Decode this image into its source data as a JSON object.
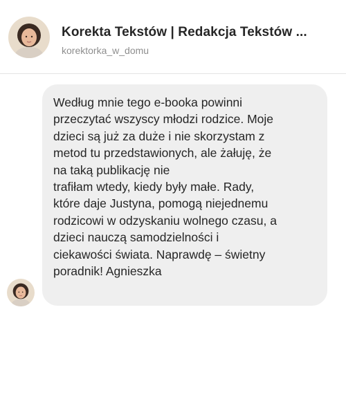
{
  "header": {
    "title": "Korekta Tekstów | Redakcja Tekstów ...",
    "username": "korektorka_w_domu",
    "avatar_icon": "profile-photo"
  },
  "message": {
    "text": "Według mnie tego e-booka powinni\nprzeczytać wszyscy młodzi rodzice. Moje\ndzieci są już za duże i nie skorzystam z\nmetod tu przedstawionych, ale żałuję, że\nna taką publikację nie\ntrafiłam wtedy, kiedy były małe. Rady,\nktóre daje Justyna, pomogą niejednemu\nrodzicowi w odzyskaniu wolnego czasu, a\ndzieci nauczą samodzielności i\nciekawości świata. Naprawdę – świetny\nporadnik! Agnieszka",
    "bubble_color": "#efefef"
  }
}
